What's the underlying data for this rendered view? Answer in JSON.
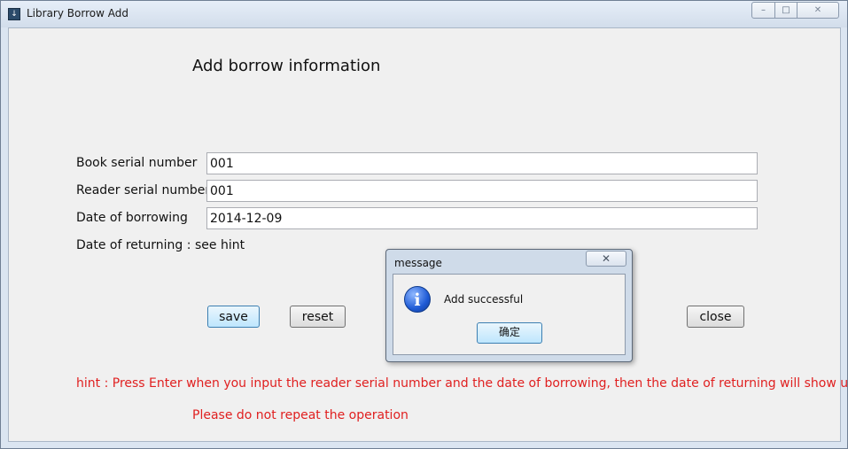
{
  "window": {
    "title": "Library Borrow Add",
    "controls": {
      "minimize": "–",
      "maximize": "□",
      "close": "✕"
    }
  },
  "form": {
    "heading": "Add borrow information",
    "book_label": "Book serial number",
    "book_value": "001",
    "reader_label": "Reader serial number",
    "reader_value": "001",
    "borrow_date_label": "Date of borrowing",
    "borrow_date_value": "2014-12-09",
    "return_label": "Date of returning :",
    "return_value": "see hint"
  },
  "buttons": {
    "save": "save",
    "reset": "reset",
    "close": "close"
  },
  "hints": {
    "hint": "hint : Press Enter when you input the reader serial number and the date of borrowing, then the date of returning will show up",
    "warning": "Please do not repeat the operation"
  },
  "dialog": {
    "title": "message",
    "close": "✕",
    "icon": "info-icon",
    "message": "Add successful",
    "ok_label": "确定"
  },
  "colors": {
    "hint_text": "#e02020",
    "focus_button": "#bee6fd"
  }
}
